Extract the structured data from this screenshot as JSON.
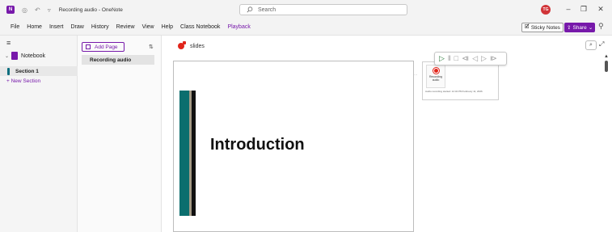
{
  "window": {
    "title": "Recording audio - OneNote",
    "search_placeholder": "Search",
    "avatar_initials": "TG"
  },
  "menu": {
    "items": [
      "File",
      "Home",
      "Insert",
      "Draw",
      "History",
      "Review",
      "View",
      "Help",
      "Class Notebook",
      "Playback"
    ],
    "active": "Playback",
    "sticky_notes": "Sticky Notes",
    "share": "Share"
  },
  "notebooks": {
    "notebook_name": "Notebook",
    "section_name": "Section 1",
    "section_color": "#0b6e7e",
    "new_section": "+ New Section"
  },
  "pages": {
    "add_page": "Add Page",
    "items": [
      "Recording audio"
    ]
  },
  "canvas": {
    "page_title": "slides",
    "slide_heading": "Introduction",
    "audio_label": "Recording audio",
    "audio_caption": "Audio recording started: 12:34 PM February 11, 2026"
  },
  "playback_controls": [
    "play",
    "pause",
    "stop",
    "rewind",
    "rewind-short",
    "forward-short",
    "forward"
  ],
  "colors": {
    "accent": "#7719aa",
    "record": "#e1251b",
    "play": "#2b7a3c"
  }
}
